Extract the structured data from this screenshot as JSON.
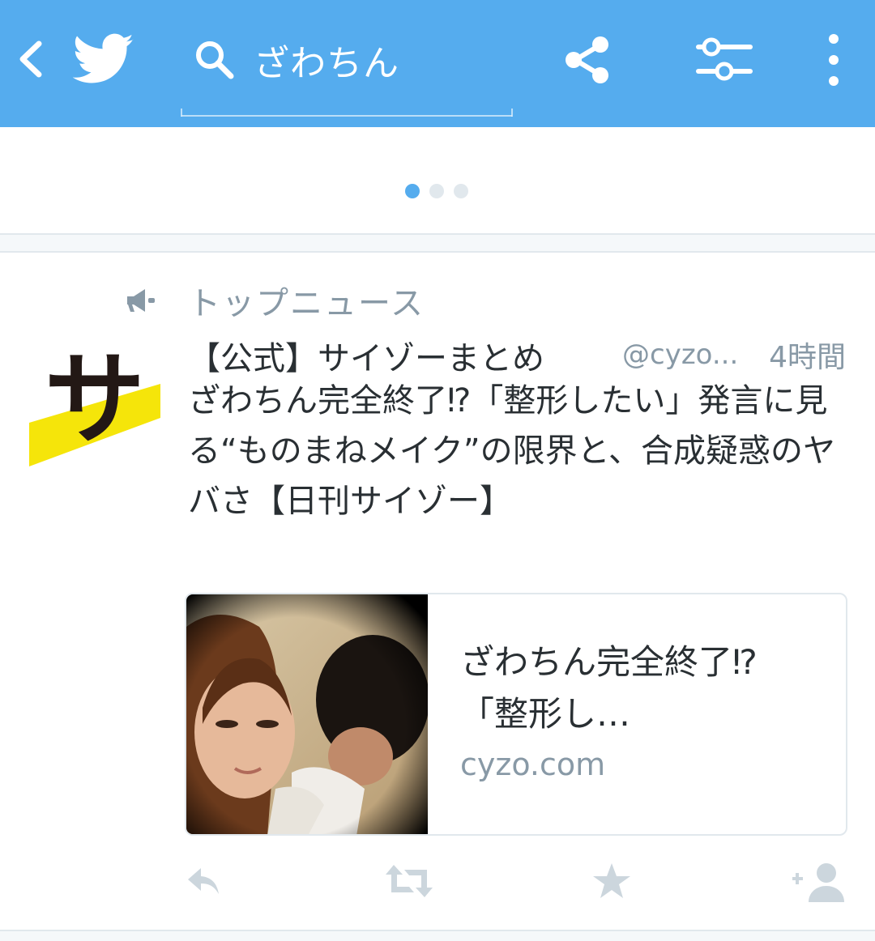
{
  "topbar": {
    "search_query": "ざわちん",
    "icons": [
      "back-icon",
      "twitter-bird-icon",
      "search-icon",
      "share-icon",
      "filter-icon",
      "more-icon"
    ],
    "background_color": "#55acee"
  },
  "carousel": {
    "page_count": 3,
    "active_index": 0
  },
  "tweet": {
    "context_label": "トップニュース",
    "author_name": "【公式】サイゾーまとめ",
    "author_handle": "@cyzo...",
    "time": "4時間",
    "text": "ざわちん完全終了⁉「整形したい」発言に見る“ものまねメイク”の限界と、合成疑惑のヤバさ【日刊サイゾー】",
    "avatar_letter": "サ",
    "card": {
      "title": "ざわちん完全終了⁉「整形し…",
      "domain": "cyzo.com"
    },
    "actions": [
      "reply-icon",
      "retweet-icon",
      "favorite-icon",
      "follow-icon"
    ]
  },
  "colors": {
    "accent": "#55acee",
    "muted_text": "#8899a6",
    "action_icon": "#ccd6dd",
    "avatar_yellow": "#f5e50a"
  }
}
